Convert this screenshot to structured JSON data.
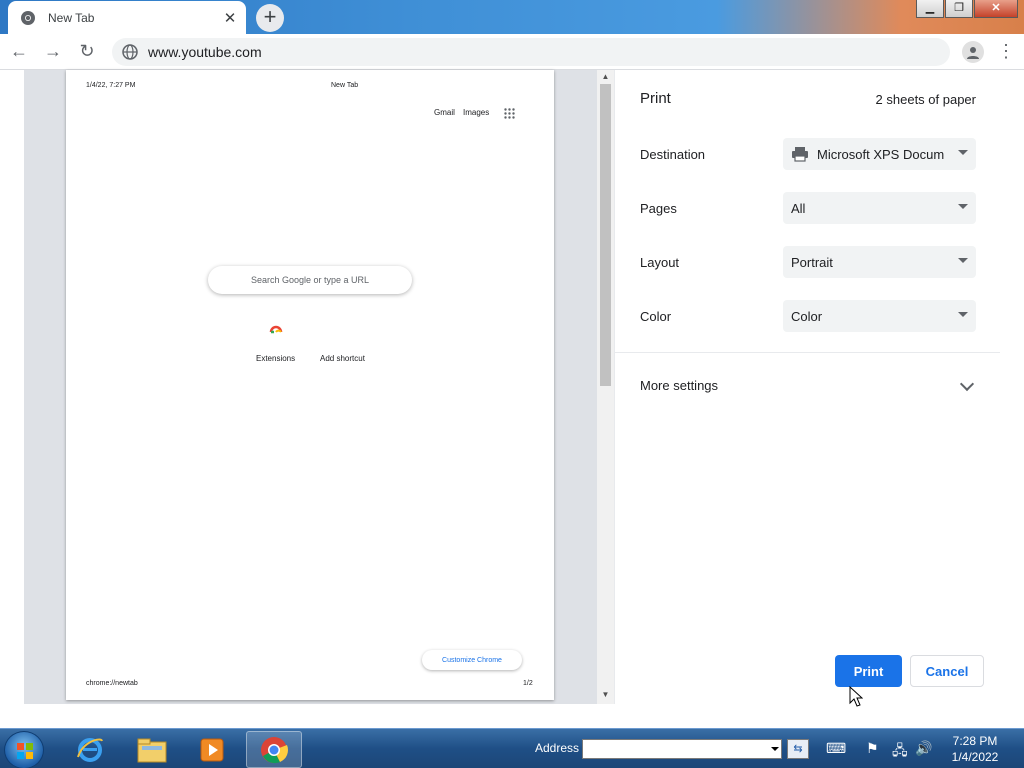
{
  "browser": {
    "tab_title": "New Tab",
    "new_tab_symbol": "+",
    "url": "www.youtube.com"
  },
  "preview": {
    "header_date": "1/4/22, 7:27 PM",
    "header_title": "New Tab",
    "link_gmail": "Gmail",
    "link_images": "Images",
    "search_placeholder": "Search Google or type a URL",
    "shortcut_extensions": "Extensions",
    "shortcut_add": "Add shortcut",
    "customize": "Customize Chrome",
    "footer_url": "chrome://newtab",
    "footer_page": "1/2"
  },
  "print": {
    "title": "Print",
    "sheets": "2 sheets of paper",
    "rows": [
      {
        "label": "Destination",
        "value": "Microsoft XPS Docum"
      },
      {
        "label": "Pages",
        "value": "All"
      },
      {
        "label": "Layout",
        "value": "Portrait"
      },
      {
        "label": "Color",
        "value": "Color"
      }
    ],
    "more_settings": "More settings",
    "print_button": "Print",
    "cancel_button": "Cancel"
  },
  "taskbar": {
    "address_label": "Address",
    "time": "7:28 PM",
    "date": "1/4/2022"
  },
  "colors": {
    "accent": "#1a73e8",
    "taskbar": "#1f4f86"
  }
}
